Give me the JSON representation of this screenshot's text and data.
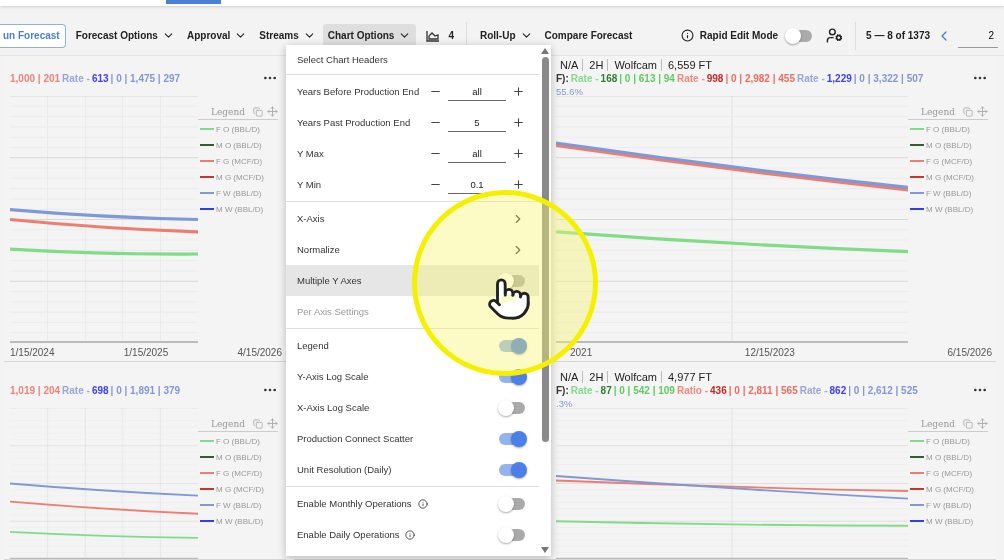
{
  "toolbar": {
    "run_button": "un Forecast",
    "menus": [
      {
        "label": "Forecast Options",
        "selected": false
      },
      {
        "label": "Approval",
        "selected": false
      },
      {
        "label": "Streams",
        "selected": false
      },
      {
        "label": "Chart Options",
        "selected": true
      }
    ],
    "chart_count": "4",
    "rollup": "Roll-Up",
    "compare": "Compare Forecast",
    "rapid_edit": {
      "label": "Rapid Edit Mode",
      "on": false
    },
    "pagination": {
      "range": "5 — 8 of 1373",
      "page": "2"
    }
  },
  "cards": [
    {
      "stats": [
        {
          "text": "1,000 | 201",
          "color": "#ec8379"
        },
        {
          "text": "Rate - ",
          "color": "#9aa6d6"
        },
        {
          "text": "613",
          "color": "#3d3df2"
        },
        {
          "text": "| 0 | 1,475 | 297",
          "color": "#8397d3"
        }
      ],
      "x_labels": [
        "1/15/2024",
        "1/15/2025",
        "4/15/2026"
      ],
      "legend": {
        "title": "Legend",
        "items": [
          {
            "label": "F O (BBL/D)",
            "color": "#80dc86"
          },
          {
            "label": "M O (BBL/D)",
            "color": "#2f5e2f"
          },
          {
            "label": "F G (MCF/D)",
            "color": "#ee7d71"
          },
          {
            "label": "M G (MCF/D)",
            "color": "#c0392b"
          },
          {
            "label": "F W (BBL/D)",
            "color": "#7f98d6"
          },
          {
            "label": "M W (BBL/D)",
            "color": "#2f3ff0"
          }
        ]
      }
    },
    {
      "fields": [
        "N/A",
        "2H",
        "Wolfcam",
        "6,559 FT"
      ],
      "stats_prefix": "F):",
      "stats": [
        {
          "text": "Rate - ",
          "color": "#86d98a"
        },
        {
          "text": "168",
          "color": "#2e7d32"
        },
        {
          "text": "| 0 | 613 | 94",
          "color": "#5fcc63"
        },
        {
          "text": "Rate - ",
          "color": "#f08a80"
        },
        {
          "text": "998",
          "color": "#c62828"
        },
        {
          "text": "| 0 | 2,982 | 455",
          "color": "#ef6b5f"
        },
        {
          "text": "Rate - ",
          "color": "#9aa6d6"
        },
        {
          "text": "1,229",
          "color": "#3d3df2"
        },
        {
          "text": "| 0 | 3,322 | 507",
          "color": "#8397d3"
        }
      ],
      "note": "55.6%",
      "x_labels": [
        "2021",
        "12/15/2023",
        "6/15/2026"
      ],
      "legend": {
        "title": "Legend",
        "items": [
          {
            "label": "F O (BBL/D)",
            "color": "#80dc86"
          },
          {
            "label": "M O (BBL/D)",
            "color": "#2f5e2f"
          },
          {
            "label": "F G (MCF/D)",
            "color": "#ee7d71"
          },
          {
            "label": "M G (MCF/D)",
            "color": "#c0392b"
          },
          {
            "label": "F W (BBL/D)",
            "color": "#7f98d6"
          },
          {
            "label": "M W (BBL/D)",
            "color": "#2f3ff0"
          }
        ]
      }
    },
    {
      "stats": [
        {
          "text": "1,019 | 204",
          "color": "#ec8379"
        },
        {
          "text": "Rate - ",
          "color": "#9aa6d6"
        },
        {
          "text": "698",
          "color": "#3d3df2"
        },
        {
          "text": "| 0 | 1,891 | 379",
          "color": "#8397d3"
        }
      ],
      "legend": {
        "title": "Legend",
        "items": [
          {
            "label": "F O (BBL/D)",
            "color": "#80dc86"
          },
          {
            "label": "M O (BBL/D)",
            "color": "#2f5e2f"
          },
          {
            "label": "F G (MCF/D)",
            "color": "#ee7d71"
          },
          {
            "label": "M G (MCF/D)",
            "color": "#c0392b"
          },
          {
            "label": "F W (BBL/D)",
            "color": "#7f98d6"
          },
          {
            "label": "M W (BBL/D)",
            "color": "#2f3ff0"
          }
        ]
      }
    },
    {
      "fields": [
        "N/A",
        "2H",
        "Wolfcam",
        "4,977 FT"
      ],
      "stats_prefix": "F):",
      "stats": [
        {
          "text": "Rate - ",
          "color": "#86d98a"
        },
        {
          "text": "87",
          "color": "#2e7d32"
        },
        {
          "text": "| 0 | 542 | 109",
          "color": "#5fcc63"
        },
        {
          "text": "Ratio - ",
          "color": "#f08a80"
        },
        {
          "text": "436",
          "color": "#c62828"
        },
        {
          "text": "| 0 | 2,811 | 565",
          "color": "#ef6b5f"
        },
        {
          "text": "Rate - ",
          "color": "#9aa6d6"
        },
        {
          "text": "862",
          "color": "#3d3df2"
        },
        {
          "text": "| 0 | 2,612 | 525",
          "color": "#8397d3"
        }
      ],
      "note": ".3%",
      "legend": {
        "title": "Legend",
        "items": [
          {
            "label": "F O (BBL/D)",
            "color": "#80dc86"
          },
          {
            "label": "M O (BBL/D)",
            "color": "#2f5e2f"
          },
          {
            "label": "F G (MCF/D)",
            "color": "#ee7d71"
          },
          {
            "label": "M G (MCF/D)",
            "color": "#c0392b"
          },
          {
            "label": "F W (BBL/D)",
            "color": "#7f98d6"
          },
          {
            "label": "M W (BBL/D)",
            "color": "#2f3ff0"
          }
        ]
      }
    }
  ],
  "chart_menu": {
    "header": "Select Chart Headers",
    "sections": [
      {
        "items": [
          {
            "kind": "stepper",
            "label": "Years Before Production End",
            "value": "all"
          },
          {
            "kind": "stepper",
            "label": "Years Past Production End",
            "value": "5"
          },
          {
            "kind": "stepper",
            "label": "Y Max",
            "value": "all"
          },
          {
            "kind": "stepper",
            "label": "Y Min",
            "value": "0.1"
          }
        ]
      },
      {
        "items": [
          {
            "kind": "submenu",
            "label": "X-Axis",
            "hovered": false
          },
          {
            "kind": "submenu",
            "label": "Normalize",
            "hovered": false
          },
          {
            "kind": "toggle",
            "label": "Multiple Y Axes",
            "on": false,
            "hovered": true,
            "info": false
          },
          {
            "kind": "subheader",
            "label": "Per Axis Settings"
          }
        ]
      },
      {
        "items": [
          {
            "kind": "toggle",
            "label": "Legend",
            "on": true,
            "hovered": false,
            "info": false
          },
          {
            "kind": "toggle",
            "label": "Y-Axis Log Scale",
            "on": true,
            "hovered": false,
            "info": false
          },
          {
            "kind": "toggle",
            "label": "X-Axis Log Scale",
            "on": false,
            "hovered": false,
            "info": false
          },
          {
            "kind": "toggle",
            "label": "Production Connect Scatter",
            "on": true,
            "hovered": false,
            "info": false
          },
          {
            "kind": "toggle",
            "label": "Unit Resolution (Daily)",
            "on": true,
            "hovered": false,
            "info": false
          }
        ]
      },
      {
        "items": [
          {
            "kind": "toggle",
            "label": "Enable Monthly Operations",
            "on": false,
            "hovered": false,
            "info": true
          },
          {
            "kind": "toggle",
            "label": "Enable Daily Operations",
            "on": false,
            "hovered": false,
            "info": true
          }
        ]
      }
    ]
  }
}
